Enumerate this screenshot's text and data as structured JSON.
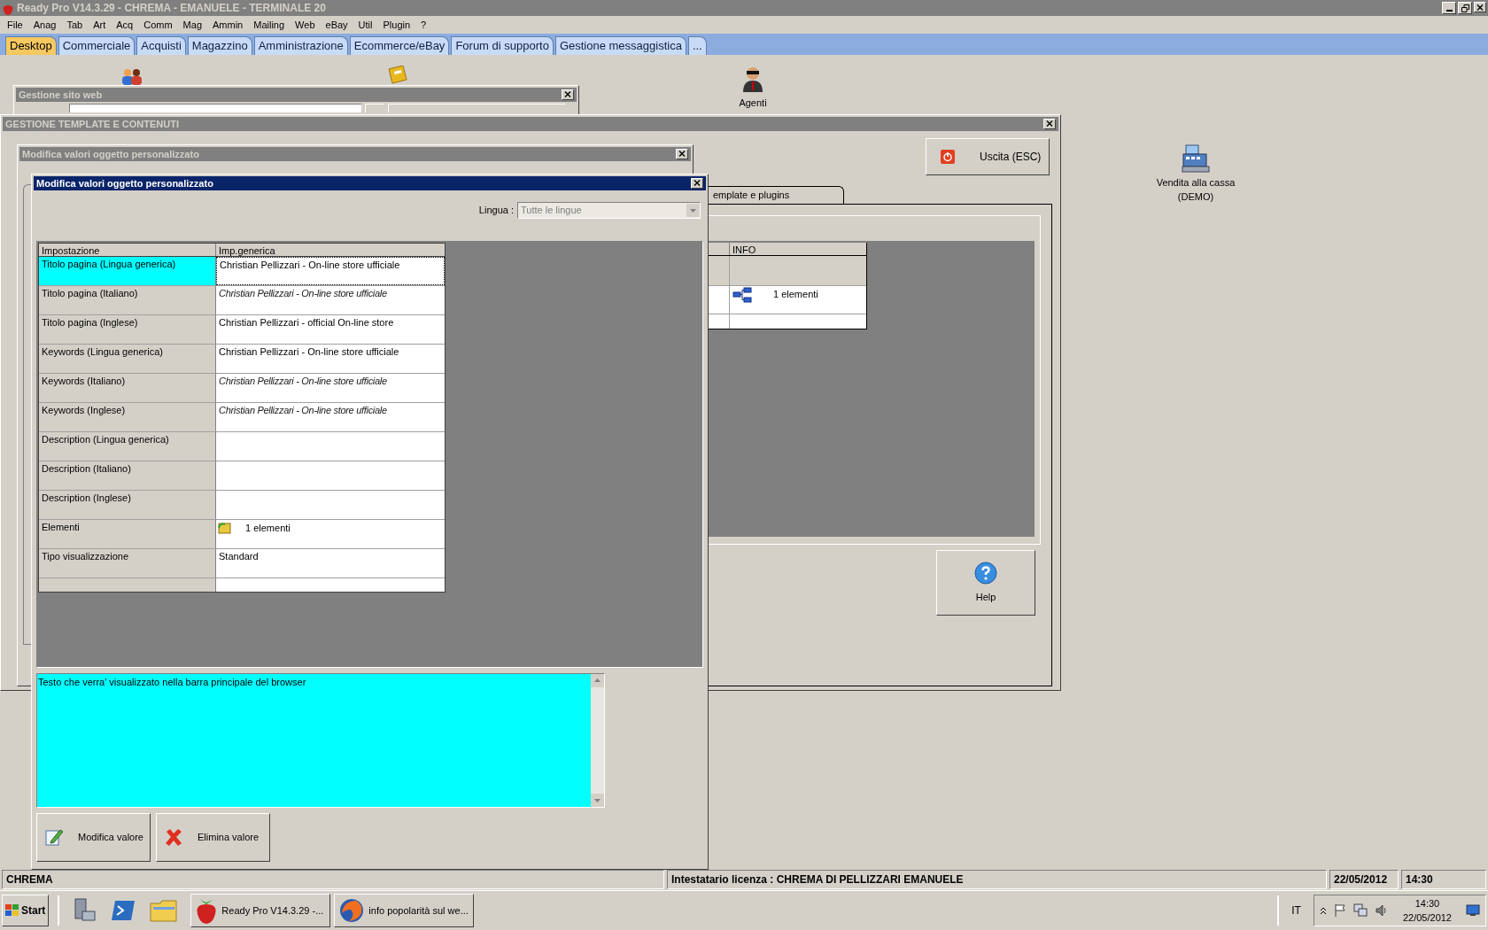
{
  "window": {
    "title": "Ready Pro V14.3.29 - CHREMA - EMANUELE - TERMINALE 20"
  },
  "menu": [
    "File",
    "Anag",
    "Tab",
    "Art",
    "Acq",
    "Comm",
    "Mag",
    "Ammin",
    "Mailing",
    "Web",
    "eBay",
    "Util",
    "Plugin",
    "?"
  ],
  "tabs": [
    {
      "label": "Desktop",
      "selected": true
    },
    {
      "label": "Commerciale",
      "selected": false
    },
    {
      "label": "Acquisti",
      "selected": false
    },
    {
      "label": "Magazzino",
      "selected": false
    },
    {
      "label": "Amministrazione",
      "selected": false
    },
    {
      "label": "Ecommerce/eBay",
      "selected": false
    },
    {
      "label": "Forum di supporto",
      "selected": false
    },
    {
      "label": "Gestione messaggistica",
      "selected": false
    },
    {
      "label": "...",
      "selected": false
    }
  ],
  "desktop_icons": [
    {
      "label": "Agenti"
    },
    {
      "label": "Vendita alla cassa (DEMO)"
    }
  ],
  "site_window": {
    "title": "Gestione sito web"
  },
  "template_window": {
    "title": "GESTIONE TEMPLATE E CONTENUTI",
    "exit_button": "Uscita (ESC)",
    "tab": "emplate e plugins",
    "column": "INFO",
    "info_value": "1 elementi",
    "help_button": "Help"
  },
  "back_dialog": {
    "title": "Modifica valori oggetto personalizzato"
  },
  "dialog": {
    "title": "Modifica valori oggetto personalizzato",
    "language_label": "Lingua :",
    "language": {
      "value": "Tutte le lingue",
      "disabled": true
    },
    "columns": [
      "Impostazione",
      "Imp.generica"
    ],
    "rows": [
      {
        "setting": "Titolo pagina (Lingua generica)",
        "value": "Christian Pellizzari - On-line store ufficiale",
        "inherited": false,
        "selected": true,
        "kind": "text"
      },
      {
        "setting": "Titolo pagina (Italiano)",
        "value": "Christian Pellizzari - On-line store ufficiale",
        "inherited": true,
        "selected": false,
        "kind": "text"
      },
      {
        "setting": "Titolo pagina (Inglese)",
        "value": "Christian Pellizzari - official On-line store",
        "inherited": false,
        "selected": false,
        "kind": "text"
      },
      {
        "setting": "Keywords (Lingua generica)",
        "value": "Christian Pellizzari - On-line store ufficiale",
        "inherited": false,
        "selected": false,
        "kind": "text"
      },
      {
        "setting": "Keywords (Italiano)",
        "value": "Christian Pellizzari - On-line store ufficiale",
        "inherited": true,
        "selected": false,
        "kind": "text"
      },
      {
        "setting": "Keywords (Inglese)",
        "value": "Christian Pellizzari - On-line store ufficiale",
        "inherited": true,
        "selected": false,
        "kind": "text"
      },
      {
        "setting": "Description (Lingua generica)",
        "selected": false,
        "kind": "text"
      },
      {
        "setting": "Description (Italiano)",
        "selected": false,
        "kind": "text"
      },
      {
        "setting": "Description (Inglese)",
        "selected": false,
        "kind": "text"
      },
      {
        "setting": "Elementi",
        "value": "1 elementi",
        "selected": false,
        "kind": "elements"
      },
      {
        "setting": "Tipo visualizzazione",
        "value": "Standard",
        "inherited": false,
        "selected": false,
        "kind": "text"
      }
    ],
    "description": "Testo che verra' visualizzato nella barra principale del browser",
    "buttons": [
      {
        "label": "Modifica valore",
        "kind": "edit"
      },
      {
        "label": "Elimina valore",
        "kind": "delete"
      }
    ]
  },
  "status_bar": [
    "CHREMA",
    "Intestatario licenza : CHREMA DI PELLIZZARI EMANUELE",
    "22/05/2012",
    "14:30"
  ],
  "taskbar": {
    "start": "Start",
    "tasks": [
      {
        "label": "Ready Pro V14.3.29 -...",
        "kind": "app"
      },
      {
        "label": "info popolarità sul we...",
        "kind": "browser"
      }
    ],
    "language": "IT",
    "clock_time": "14:30",
    "clock_date": "22/05/2012"
  }
}
